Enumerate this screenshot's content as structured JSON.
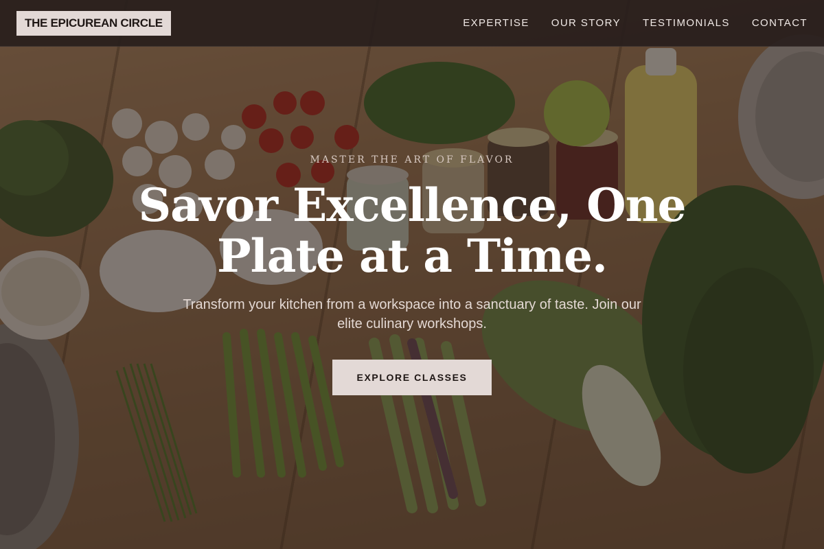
{
  "header": {
    "logo": "THE EPICUREAN CIRCLE",
    "nav": [
      "EXPERTISE",
      "OUR STORY",
      "TESTIMONIALS",
      "CONTACT"
    ]
  },
  "hero": {
    "eyebrow": "MASTER THE ART OF FLAVOR",
    "title": "Savor Excellence, One Plate at a Time.",
    "subtitle": "Transform your kitchen from a workspace into a sanctuary of taste. Join our elite culinary workshops.",
    "cta_label": "EXPLORE CLASSES",
    "background_image": "kitchen-table-with-vegetables"
  },
  "colors": {
    "header_bg": "#28201e",
    "accent_light": "#e3d9d6",
    "text_dark": "#1e1614",
    "text_light": "#ffffff"
  }
}
